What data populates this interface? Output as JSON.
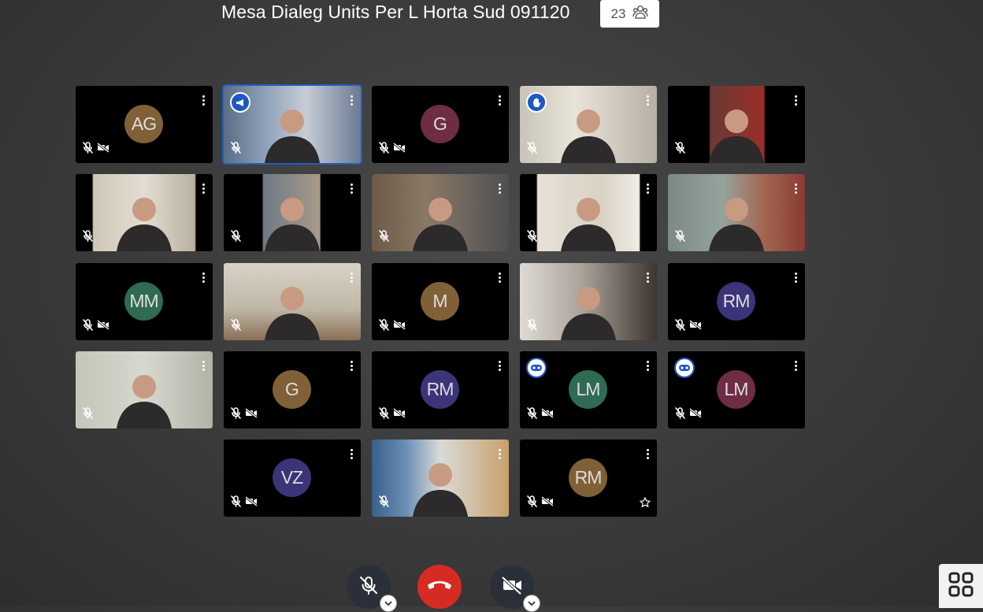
{
  "meeting": {
    "title": "Mesa Dialeg Units Per L Horta Sud 091120",
    "participant_count": "23"
  },
  "icons": {
    "participants": "people-group-icon",
    "more": "kebab-menu-icon",
    "mic_off": "mic-off-icon",
    "cam_off": "camera-off-icon",
    "raised_hand": "raised-hand-icon",
    "presenter": "megaphone-icon",
    "moderator": "moderator-icon",
    "star": "star-outline-icon",
    "layout": "tile-grid-icon"
  },
  "colors": {
    "active_border": "#1e5fbf",
    "hangup": "#d62b23",
    "control_dark": "#2b2f3a"
  },
  "tiles": [
    {
      "initials": "AG",
      "avatar_color": "#806036"
    },
    {
      "initials": "",
      "video": true,
      "active": true,
      "badge": "presenter"
    },
    {
      "initials": "G",
      "avatar_color": "#6e2c45"
    },
    {
      "initials": "",
      "video": true,
      "badge": "raised_hand"
    },
    {
      "initials": "",
      "video": true
    },
    {
      "initials": "",
      "video": true
    },
    {
      "initials": "",
      "video": true
    },
    {
      "initials": "",
      "video": true
    },
    {
      "initials": "",
      "video": true
    },
    {
      "initials": "",
      "video": true
    },
    {
      "initials": "MM",
      "avatar_color": "#2f6a52"
    },
    {
      "initials": "",
      "video": true
    },
    {
      "initials": "M",
      "avatar_color": "#806036"
    },
    {
      "initials": "",
      "video": true
    },
    {
      "initials": "RM",
      "avatar_color": "#3b3478"
    },
    {
      "initials": "",
      "video": true
    },
    {
      "initials": "G",
      "avatar_color": "#806036"
    },
    {
      "initials": "RM",
      "avatar_color": "#3b3478"
    },
    {
      "initials": "LM",
      "avatar_color": "#2f6a52",
      "badge": "moderator"
    },
    {
      "initials": "LM",
      "avatar_color": "#6e2c45",
      "badge": "moderator"
    },
    {
      "initials": "VZ",
      "avatar_color": "#3b3478"
    },
    {
      "initials": "",
      "video": true
    },
    {
      "initials": "RM",
      "avatar_color": "#806036",
      "star": true
    }
  ]
}
